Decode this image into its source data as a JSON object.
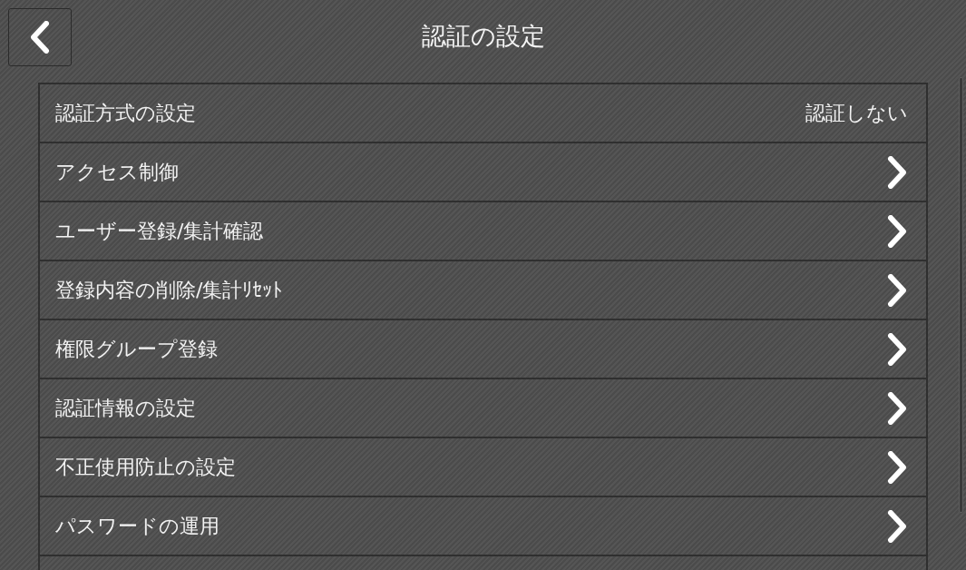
{
  "header": {
    "title": "認証の設定"
  },
  "items": [
    {
      "kind": "value",
      "label": "認証方式の設定",
      "value": "認証しない"
    },
    {
      "kind": "link",
      "label": "アクセス制御"
    },
    {
      "kind": "link",
      "label": "ユーザー登録/集計確認"
    },
    {
      "kind": "link",
      "label": "登録内容の削除/集計ﾘｾｯﾄ"
    },
    {
      "kind": "link",
      "label": "権限グループ登録"
    },
    {
      "kind": "link",
      "label": "認証情報の設定"
    },
    {
      "kind": "link",
      "label": "不正使用防止の設定"
    },
    {
      "kind": "link",
      "label": "パスワードの運用"
    }
  ]
}
